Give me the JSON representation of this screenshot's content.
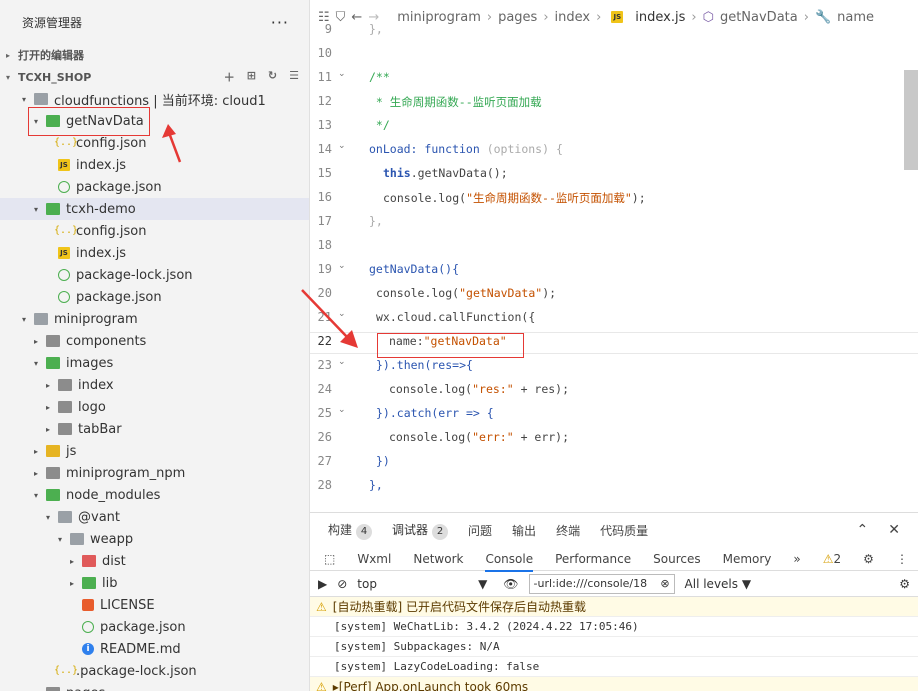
{
  "sidebar": {
    "title": "资源管理器",
    "more_label": "···",
    "open_editors_label": "打开的编辑器",
    "project_label": "TCXH_SHOP",
    "tree": [
      {
        "label": "cloudfunctions | 当前环境: cloud1",
        "icon": "folder-open-icon",
        "depth": 1,
        "twisty": "▾"
      },
      {
        "label": "getNavData",
        "icon": "cloud-folder-icon",
        "depth": 2,
        "twisty": "▾"
      },
      {
        "label": "config.json",
        "icon": "json-file-icon",
        "depth": 3,
        "twisty": ""
      },
      {
        "label": "index.js",
        "icon": "js-file-icon",
        "depth": 3,
        "twisty": ""
      },
      {
        "label": "package.json",
        "icon": "npm-file-icon",
        "depth": 3,
        "twisty": ""
      },
      {
        "label": "tcxh-demo",
        "icon": "cloud-folder-icon",
        "depth": 2,
        "twisty": "▾",
        "selected": true
      },
      {
        "label": "config.json",
        "icon": "json-file-icon",
        "depth": 3,
        "twisty": ""
      },
      {
        "label": "index.js",
        "icon": "js-file-icon",
        "depth": 3,
        "twisty": ""
      },
      {
        "label": "package-lock.json",
        "icon": "npm-file-icon",
        "depth": 3,
        "twisty": ""
      },
      {
        "label": "package.json",
        "icon": "npm-file-icon",
        "depth": 3,
        "twisty": ""
      },
      {
        "label": "miniprogram",
        "icon": "folder-open-icon",
        "depth": 1,
        "twisty": "▾"
      },
      {
        "label": "components",
        "icon": "folder-icon",
        "depth": 2,
        "twisty": "▸"
      },
      {
        "label": "images",
        "icon": "image-folder-icon",
        "depth": 2,
        "twisty": "▾"
      },
      {
        "label": "index",
        "icon": "folder-icon",
        "depth": 3,
        "twisty": "▸"
      },
      {
        "label": "logo",
        "icon": "folder-icon",
        "depth": 3,
        "twisty": "▸"
      },
      {
        "label": "tabBar",
        "icon": "folder-icon",
        "depth": 3,
        "twisty": "▸"
      },
      {
        "label": "js",
        "icon": "js-folder-icon",
        "depth": 2,
        "twisty": "▸"
      },
      {
        "label": "miniprogram_npm",
        "icon": "folder-icon",
        "depth": 2,
        "twisty": "▸"
      },
      {
        "label": "node_modules",
        "icon": "node-folder-icon",
        "depth": 2,
        "twisty": "▾"
      },
      {
        "label": "@vant",
        "icon": "folder-open-icon",
        "depth": 3,
        "twisty": "▾"
      },
      {
        "label": "weapp",
        "icon": "folder-open-icon",
        "depth": 4,
        "twisty": "▾"
      },
      {
        "label": "dist",
        "icon": "dist-folder-icon",
        "depth": 5,
        "twisty": "▸"
      },
      {
        "label": "lib",
        "icon": "lib-folder-icon",
        "depth": 5,
        "twisty": "▸"
      },
      {
        "label": "LICENSE",
        "icon": "license-icon",
        "depth": 5,
        "twisty": ""
      },
      {
        "label": "package.json",
        "icon": "npm-file-icon",
        "depth": 5,
        "twisty": ""
      },
      {
        "label": "README.md",
        "icon": "info-icon",
        "depth": 5,
        "twisty": ""
      },
      {
        "label": ".package-lock.json",
        "icon": "json-file-icon",
        "depth": 3,
        "twisty": ""
      },
      {
        "label": "pages",
        "icon": "folder-icon",
        "depth": 2,
        "twisty": "▸"
      }
    ]
  },
  "editor": {
    "breadcrumbs": [
      "miniprogram",
      "pages",
      "index",
      "index.js",
      "getNavData",
      "name"
    ],
    "lines": [
      {
        "n": "9",
        "fold": false
      },
      {
        "n": "10",
        "fold": false
      },
      {
        "n": "11",
        "fold": true
      },
      {
        "n": "12",
        "fold": false
      },
      {
        "n": "13",
        "fold": false
      },
      {
        "n": "14",
        "fold": true
      },
      {
        "n": "15",
        "fold": false
      },
      {
        "n": "16",
        "fold": false
      },
      {
        "n": "17",
        "fold": false
      },
      {
        "n": "18",
        "fold": false
      },
      {
        "n": "19",
        "fold": true
      },
      {
        "n": "20",
        "fold": false
      },
      {
        "n": "21",
        "fold": true
      },
      {
        "n": "22",
        "fold": false
      },
      {
        "n": "23",
        "fold": true
      },
      {
        "n": "24",
        "fold": false
      },
      {
        "n": "25",
        "fold": true
      },
      {
        "n": "26",
        "fold": false
      },
      {
        "n": "27",
        "fold": false
      },
      {
        "n": "28",
        "fold": false
      }
    ],
    "code": {
      "l9": "},",
      "l11": "/**",
      "l12": " * 生命周期函数--监听页面加载",
      "l13": " */",
      "l14a": "onLoad: ",
      "l14b": "function",
      "l14c": " (options) {",
      "l15a": "this",
      "l15b": ".getNavData();",
      "l16a": "console.log(",
      "l16b": "\"生命周期函数--监听页面加载\"",
      "l16c": ");",
      "l17": "},",
      "l19": "getNavData(){",
      "l20a": "console.log(",
      "l20b": "\"getNavData\"",
      "l20c": ");",
      "l21": "wx.cloud.callFunction({",
      "l22a": "name:",
      "l22b": "\"getNavData\"",
      "l23": "}).then(res=>{",
      "l24a": "console.log(",
      "l24b": "\"res:\"",
      "l24c": " + res);",
      "l25": "}).catch(err => {",
      "l26a": "console.log(",
      "l26b": "\"err:\"",
      "l26c": " + err);",
      "l27": "})",
      "l28": "},"
    }
  },
  "panel": {
    "tabs": [
      {
        "label": "构建",
        "badge": "4"
      },
      {
        "label": "调试器",
        "badge": "2"
      },
      {
        "label": "问题",
        "badge": ""
      },
      {
        "label": "输出",
        "badge": ""
      },
      {
        "label": "终端",
        "badge": ""
      },
      {
        "label": "代码质量",
        "badge": ""
      }
    ],
    "devtools_tabs": [
      "Wxml",
      "Network",
      "Console",
      "Performance",
      "Sources",
      "Memory"
    ],
    "overflow_label": "»",
    "warning_count": "2",
    "context_select": "top",
    "filter_value": "-url:ide:///console/18",
    "levels_label": "All levels ▼",
    "logs": [
      {
        "type": "warn",
        "text": "[自动热重载] 已开启代码文件保存后自动热重载"
      },
      {
        "type": "log",
        "text": "[system] WeChatLib: 3.4.2 (2024.4.22 17:05:46)"
      },
      {
        "type": "log",
        "text": "[system] Subpackages: N/A"
      },
      {
        "type": "log",
        "text": "[system] LazyCodeLoading: false"
      },
      {
        "type": "warn",
        "text": "▸[Perf] App.onLaunch took 60ms"
      }
    ]
  },
  "colors": {
    "accent": "#1a73e8",
    "annotation": "#e53935",
    "keyword": "#2b55b0",
    "string": "#c45100",
    "comment": "#34a853"
  }
}
